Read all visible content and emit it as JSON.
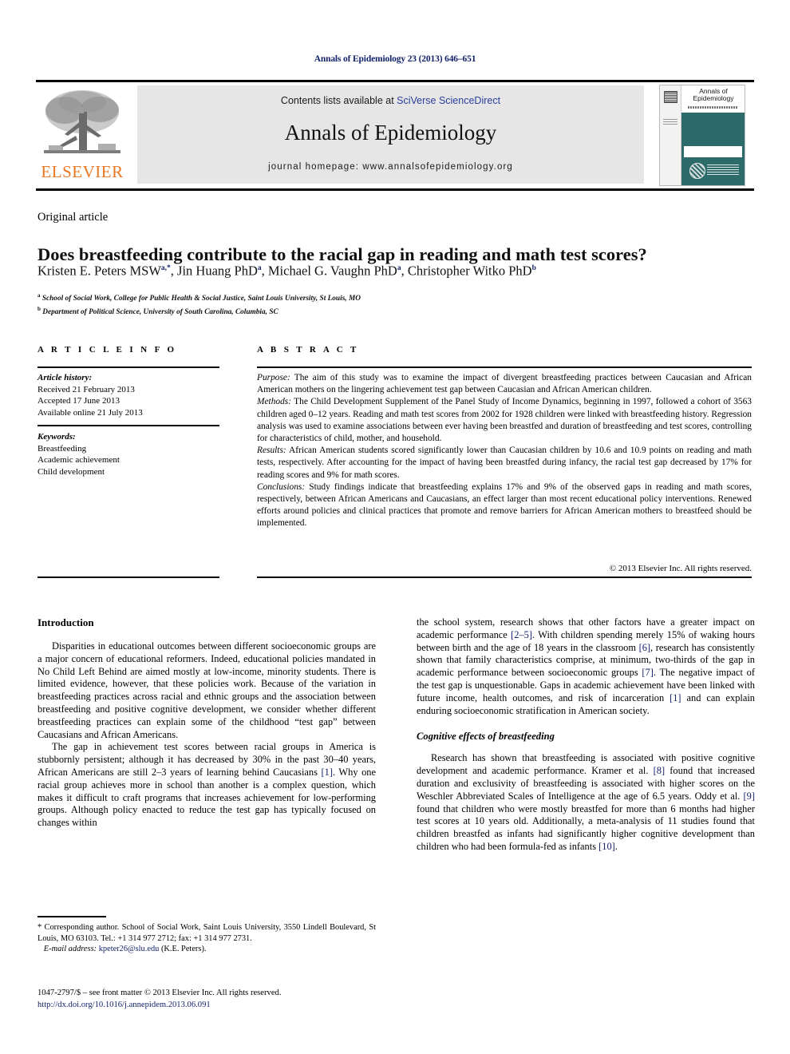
{
  "running_head": "Annals of Epidemiology 23 (2013) 646–651",
  "masthead": {
    "contents_prefix": "Contents lists available at ",
    "sciencedirect": "SciVerse ScienceDirect",
    "journal_title": "Annals of Epidemiology",
    "homepage_label": "journal homepage: www.annalsofepidemiology.org",
    "publisher_wordmark": "ELSEVIER",
    "cover_title": "Annals of Epidemiology"
  },
  "article": {
    "type": "Original article",
    "title": "Does breastfeeding contribute to the racial gap in reading and math test scores?",
    "authors_html": "Kristen E. Peters MSW<sup>a,*</sup>, Jin Huang PhD<sup>a</sup>, Michael G. Vaughn PhD<sup>a</sup>, Christopher Witko PhD<sup>b</sup>",
    "affiliation_a": "School of Social Work, College for Public Health & Social Justice, Saint Louis University, St Louis, MO",
    "affiliation_b": "Department of Political Science, University of South Carolina, Columbia, SC"
  },
  "info": {
    "heading": "A R T I C L E  I N F O",
    "history_label": "Article history:",
    "received": "Received 21 February 2013",
    "accepted": "Accepted 17 June 2013",
    "available": "Available online 21 July 2013",
    "keywords_label": "Keywords:",
    "keywords": [
      "Breastfeeding",
      "Academic achievement",
      "Child development"
    ]
  },
  "abstract": {
    "heading": "A B S T R A C T",
    "purpose_label": "Purpose:",
    "purpose": " The aim of this study was to examine the impact of divergent breastfeeding practices between Caucasian and African American mothers on the lingering achievement test gap between Caucasian and African American children.",
    "methods_label": "Methods:",
    "methods": " The Child Development Supplement of the Panel Study of Income Dynamics, beginning in 1997, followed a cohort of 3563 children aged 0–12 years. Reading and math test scores from 2002 for 1928 children were linked with breastfeeding history. Regression analysis was used to examine associations between ever having been breastfed and duration of breastfeeding and test scores, controlling for characteristics of child, mother, and household.",
    "results_label": "Results:",
    "results": " African American students scored significantly lower than Caucasian children by 10.6 and 10.9 points on reading and math tests, respectively. After accounting for the impact of having been breastfed during infancy, the racial test gap decreased by 17% for reading scores and 9% for math scores.",
    "conclusions_label": "Conclusions:",
    "conclusions": " Study findings indicate that breastfeeding explains 17% and 9% of the observed gaps in reading and math scores, respectively, between African Americans and Caucasians, an effect larger than most recent educational policy interventions. Renewed efforts around policies and clinical practices that promote and remove barriers for African American mothers to breastfeed should be implemented.",
    "copyright": "© 2013 Elsevier Inc. All rights reserved."
  },
  "body": {
    "intro_heading": "Introduction",
    "intro_p1": "Disparities in educational outcomes between different socioeconomic groups are a major concern of educational reformers. Indeed, educational policies mandated in No Child Left Behind are aimed mostly at low-income, minority students. There is limited evidence, however, that these policies work. Because of the variation in breastfeeding practices across racial and ethnic groups and the association between breastfeeding and positive cognitive development, we consider whether different breastfeeding practices can explain some of the childhood “test gap” between Caucasians and African Americans.",
    "intro_p2_a": "The gap in achievement test scores between racial groups in America is stubbornly persistent; although it has decreased by 30% in the past 30–40 years, African Americans are still 2–3 years of learning behind Caucasians ",
    "intro_p2_ref1": "[1]",
    "intro_p2_b": ". Why one racial group achieves more in school than another is a complex question, which makes it difficult to craft programs that increases achievement for low-performing groups. Although policy enacted to reduce the test gap has typically focused on changes within",
    "right_p1_a": "the school system, research shows that other factors have a greater impact on academic performance ",
    "right_p1_ref1": "[2–5]",
    "right_p1_b": ". With children spending merely 15% of waking hours between birth and the age of 18 years in the classroom ",
    "right_p1_ref2": "[6]",
    "right_p1_c": ", research has consistently shown that family characteristics comprise, at minimum, two-thirds of the gap in academic performance between socioeconomic groups ",
    "right_p1_ref3": "[7]",
    "right_p1_d": ". The negative impact of the test gap is unquestionable. Gaps in academic achievement have been linked with future income, health outcomes, and risk of incarceration ",
    "right_p1_ref4": "[1]",
    "right_p1_e": " and can explain enduring socioeconomic stratification in American society.",
    "cognitive_heading": "Cognitive effects of breastfeeding",
    "cognitive_p_a": "Research has shown that breastfeeding is associated with positive cognitive development and academic performance. Kramer et al. ",
    "cognitive_ref1": "[8]",
    "cognitive_p_b": " found that increased duration and exclusivity of breastfeeding is associated with higher scores on the Weschler Abbreviated Scales of Intelligence at the age of 6.5 years. Oddy et al. ",
    "cognitive_ref2": "[9]",
    "cognitive_p_c": " found that children who were mostly breastfed for more than 6 months had higher test scores at 10 years old. Additionally, a meta-analysis of 11 studies found that children breastfed as infants had significantly higher cognitive development than children who had been formula-fed as infants ",
    "cognitive_ref3": "[10]",
    "cognitive_p_d": "."
  },
  "footnote": {
    "corresponding_a": "* Corresponding author. School of Social Work, Saint Louis University, 3550 Lindell Boulevard, St Louis, MO 63103. Tel.: +1 314 977 2712; fax: +1 314 977 2731.",
    "email_label": "E-mail address:",
    "email": "kpeter26@slu.edu",
    "email_suffix": " (K.E. Peters).",
    "imprint": "1047-2797/$ – see front matter © 2013 Elsevier Inc. All rights reserved.",
    "doi": "http://dx.doi.org/10.1016/j.annepidem.2013.06.091"
  },
  "colors": {
    "link_navy": "#14236b",
    "sciencedirect_blue": "#2b3f9e",
    "elsevier_orange": "#e87722",
    "masthead_gray": "#e6e6e6",
    "cover_teal": "#2d6b6b"
  }
}
